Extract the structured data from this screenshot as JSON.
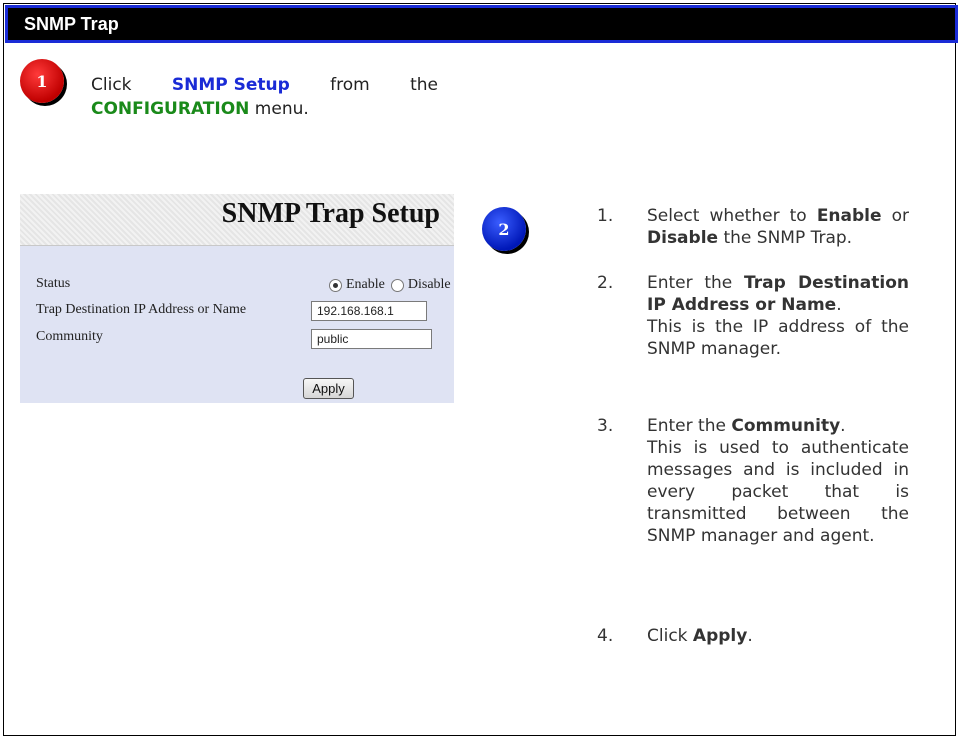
{
  "header": {
    "title": "SNMP Trap"
  },
  "step1": {
    "badge": "1",
    "word_click": "Click",
    "link_label": "SNMP Setup",
    "word_from": "from",
    "word_the": "the",
    "menu_label": "CONFIGURATION",
    "word_menu": "menu."
  },
  "panel": {
    "title": "SNMP Trap Setup",
    "status_label": "Status",
    "status_options": [
      "Enable",
      "Disable"
    ],
    "status_selected": "Enable",
    "trap_dest_label": "Trap Destination IP Address or Name",
    "trap_dest_value": "192.168.168.1",
    "community_label": "Community",
    "community_value": "public",
    "apply_label": "Apply"
  },
  "step2": {
    "badge": "2",
    "items": [
      {
        "num": "1.",
        "pre": "Select whether to",
        "b1": "Enable",
        "mid": "or",
        "b2": "Disable",
        "post": "the SNMP Trap."
      },
      {
        "num": "2.",
        "pre": "Enter the",
        "bold": "Trap Destination IP Address or Name",
        "post": ".",
        "extra": "This is the IP address of the SNMP manager."
      },
      {
        "num": "3.",
        "pre": "Enter the",
        "bold": "Community",
        "post": ".",
        "extra": "This is used to authenticate messages and is included in every packet that is transmitted between the SNMP manager and agent."
      },
      {
        "num": "4.",
        "pre": "Click",
        "bold": "Apply",
        "post": "."
      }
    ]
  }
}
